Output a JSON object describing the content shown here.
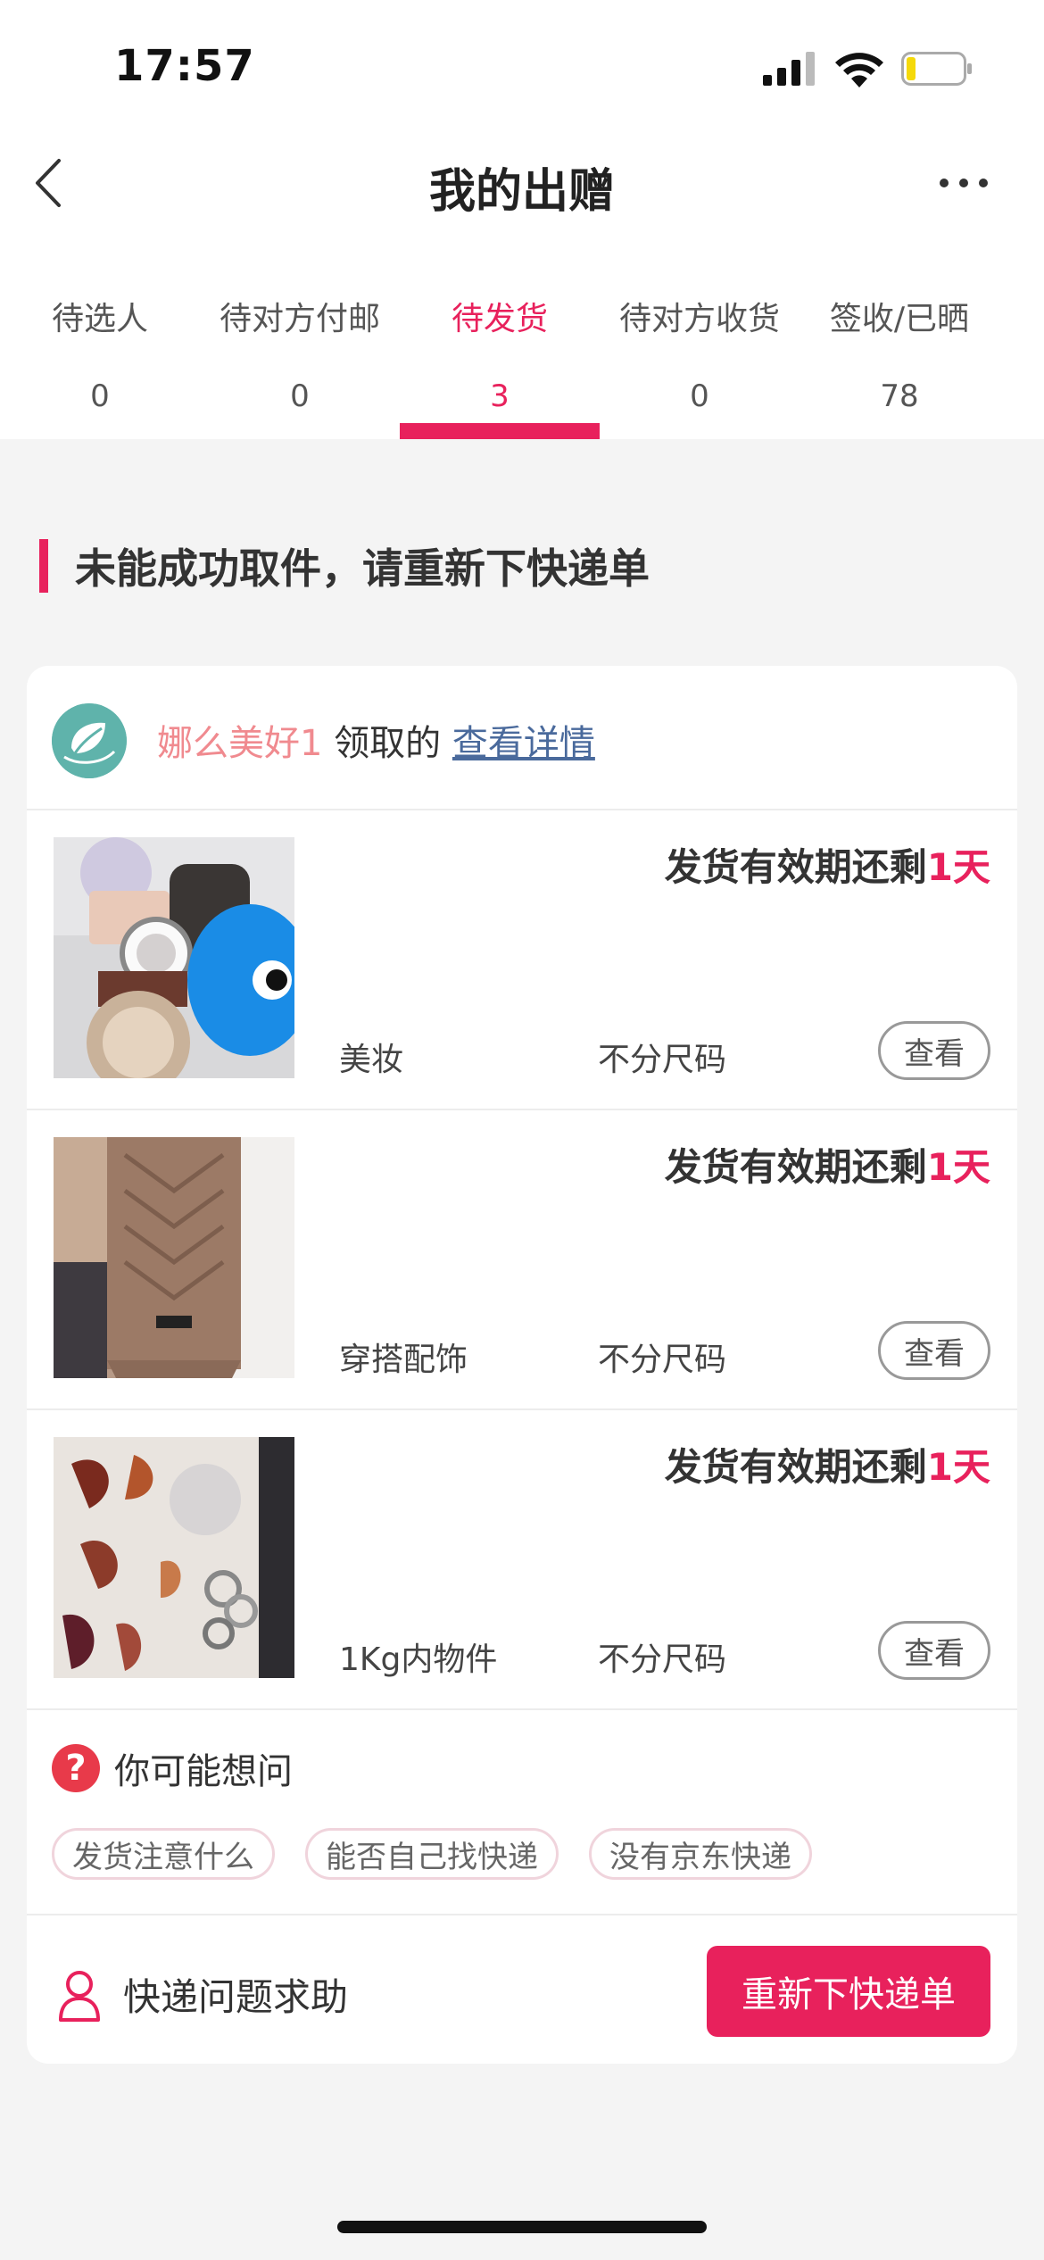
{
  "status_bar": {
    "time": "17:57"
  },
  "nav": {
    "title": "我的出赠",
    "back_icon": "chevron-left-icon",
    "more_icon": "more-horizontal-icon"
  },
  "tabs": [
    {
      "label": "待选人",
      "count": "0"
    },
    {
      "label": "待对方付邮",
      "count": "0"
    },
    {
      "label": "待发货",
      "count": "3",
      "active": true
    },
    {
      "label": "待对方收货",
      "count": "0"
    },
    {
      "label": "签收/已晒",
      "count": "78"
    }
  ],
  "notice": {
    "text": "未能成功取件，请重新下快递单"
  },
  "card": {
    "recipient_name": "娜么美好1",
    "received_text": " 领取的 ",
    "details_link": "查看详情",
    "items": [
      {
        "deadline_prefix": "发货有效期还剩",
        "deadline_value": "1天",
        "category": "美妆",
        "size": "不分尺码",
        "view_label": "查看"
      },
      {
        "deadline_prefix": "发货有效期还剩",
        "deadline_value": "1天",
        "category": "穿搭配饰",
        "size": "不分尺码",
        "view_label": "查看"
      },
      {
        "deadline_prefix": "发货有效期还剩",
        "deadline_value": "1天",
        "category": "1Kg内物件",
        "size": "不分尺码",
        "view_label": "查看"
      }
    ],
    "faq": {
      "title": "你可能想问",
      "chips": [
        "发货注意什么",
        "能否自己找快递",
        "没有京东快递"
      ]
    },
    "help": {
      "label": "快递问题求助",
      "button": "重新下快递单"
    }
  },
  "colors": {
    "accent": "#e8215c",
    "username": "#f08a8f",
    "link": "#4a6a9c"
  }
}
